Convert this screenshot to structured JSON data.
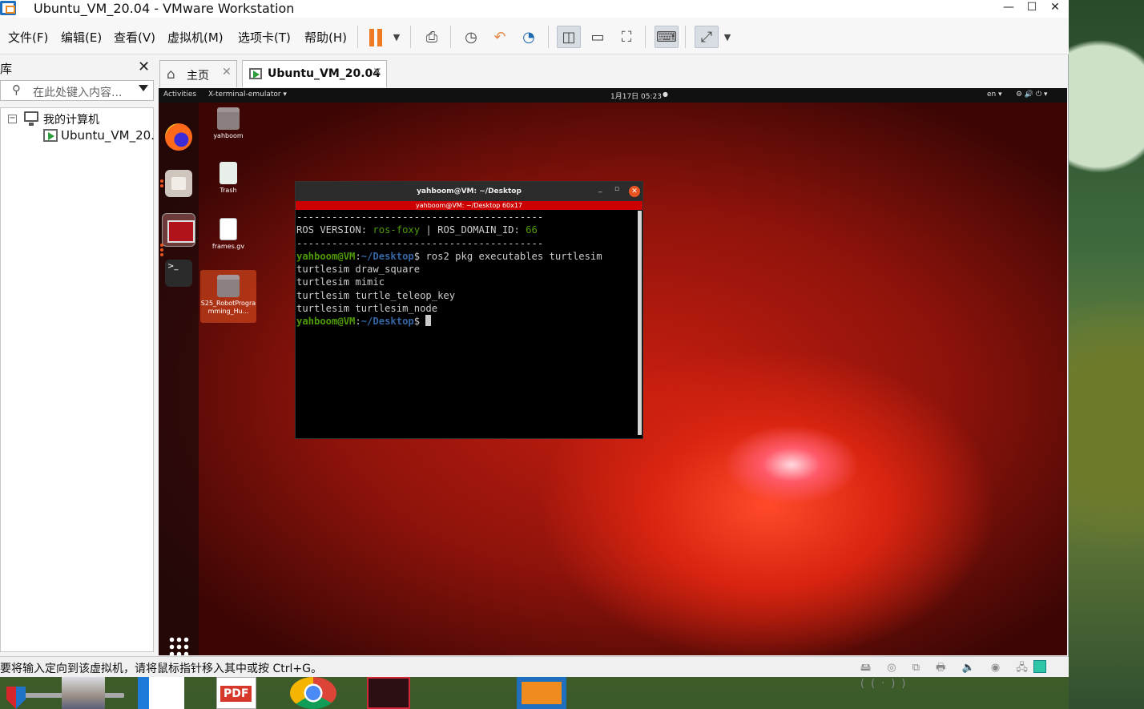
{
  "window": {
    "title": "Ubuntu_VM_20.04 - VMware Workstation",
    "controls": [
      "—",
      "☐",
      "✕"
    ]
  },
  "menubar": {
    "items": [
      "文件(F)",
      "编辑(E)",
      "查看(V)",
      "虚拟机(M)",
      "选项卡(T)",
      "帮助(H)"
    ]
  },
  "library": {
    "title": "库",
    "close": "✕",
    "search_placeholder": "在此处键入内容...",
    "tree": {
      "root": "我的计算机",
      "root_expander": "−",
      "vm": "Ubuntu_VM_20.04"
    }
  },
  "tabs": [
    {
      "label": "主页",
      "close": "✕"
    },
    {
      "label": "Ubuntu_VM_20.04",
      "close": "✕"
    }
  ],
  "guest": {
    "topbar": {
      "activities": "Activities",
      "app": "X-terminal-emulator ▾",
      "clock": "1月17日  05:23",
      "lang": "en ▾",
      "tray": "⚙ 🔊 ⏻ ▾"
    },
    "desktop_icons": [
      "yahboom",
      "Trash",
      "frames.gv",
      "S25_RobotProgramming_Hu..."
    ],
    "terminal": {
      "title": "yahboom@VM: ~/Desktop",
      "subtitle": "yahboom@VM: ~/Desktop 60x17",
      "btn_min": "_",
      "btn_max": "▫",
      "btn_close": "✕",
      "rule": "------------------------------------------",
      "ros_label": "ROS VERSION: ",
      "ros_version": "ros-foxy",
      "sep": " | ROS_DOMAIN_ID: ",
      "domain_id": "66",
      "prompt_user": "yahboom@VM",
      "prompt_colon": ":",
      "prompt_path": "~/Desktop",
      "prompt_end": "$ ",
      "command": "ros2 pkg executables turtlesim",
      "outputs": [
        "turtlesim draw_square",
        "turtlesim mimic",
        "turtlesim turtle_teleop_key",
        "turtlesim turtlesim_node"
      ]
    }
  },
  "statusbar": {
    "text": "要将输入定向到该虚拟机，请将鼠标指针移入其中或按 Ctrl+G。",
    "icons": "🖴 ◎ ⧉ 🖶 🔈 ◉ 🖧 ((·))"
  },
  "taskbar": {
    "pdf_label": "PDF"
  }
}
